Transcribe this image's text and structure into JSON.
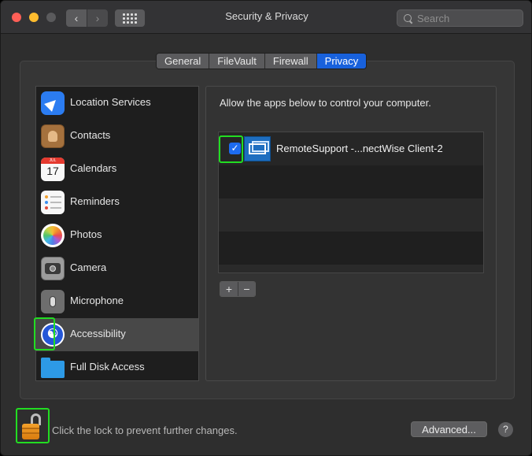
{
  "window": {
    "title": "Security & Privacy"
  },
  "toolbar": {
    "back_glyph": "‹",
    "forward_glyph": "›",
    "show_all_icon": "grid-icon"
  },
  "search": {
    "placeholder": "Search"
  },
  "tabs": [
    {
      "label": "General",
      "active": false
    },
    {
      "label": "FileVault",
      "active": false
    },
    {
      "label": "Firewall",
      "active": false
    },
    {
      "label": "Privacy",
      "active": true
    }
  ],
  "sidebar": {
    "items": [
      {
        "label": "Location Services",
        "icon": "location-arrow-icon",
        "selected": false
      },
      {
        "label": "Contacts",
        "icon": "contacts-book-icon",
        "selected": false
      },
      {
        "label": "Calendars",
        "icon": "calendar-icon",
        "selected": false,
        "icon_text_month": "JUL",
        "icon_text_day": "17"
      },
      {
        "label": "Reminders",
        "icon": "reminders-list-icon",
        "selected": false
      },
      {
        "label": "Photos",
        "icon": "photos-flower-icon",
        "selected": false
      },
      {
        "label": "Camera",
        "icon": "camera-icon",
        "selected": false
      },
      {
        "label": "Microphone",
        "icon": "microphone-icon",
        "selected": false
      },
      {
        "label": "Accessibility",
        "icon": "accessibility-icon",
        "selected": true
      },
      {
        "label": "Full Disk Access",
        "icon": "folder-icon",
        "selected": false
      }
    ]
  },
  "main": {
    "heading": "Allow the apps below to control your computer.",
    "apps": [
      {
        "name": "RemoteSupport -...nectWise Client-2",
        "checked": true,
        "icon": "remote-support-app-icon"
      }
    ],
    "add_label": "+",
    "remove_label": "−"
  },
  "footer": {
    "lock_icon": "open-lock-icon",
    "lock_text": "Click the lock to prevent further changes.",
    "advanced_label": "Advanced...",
    "help_label": "?"
  },
  "colors": {
    "accent": "#1861dc",
    "highlight": "#22dd22",
    "window_bg": "#2e2e2e"
  }
}
